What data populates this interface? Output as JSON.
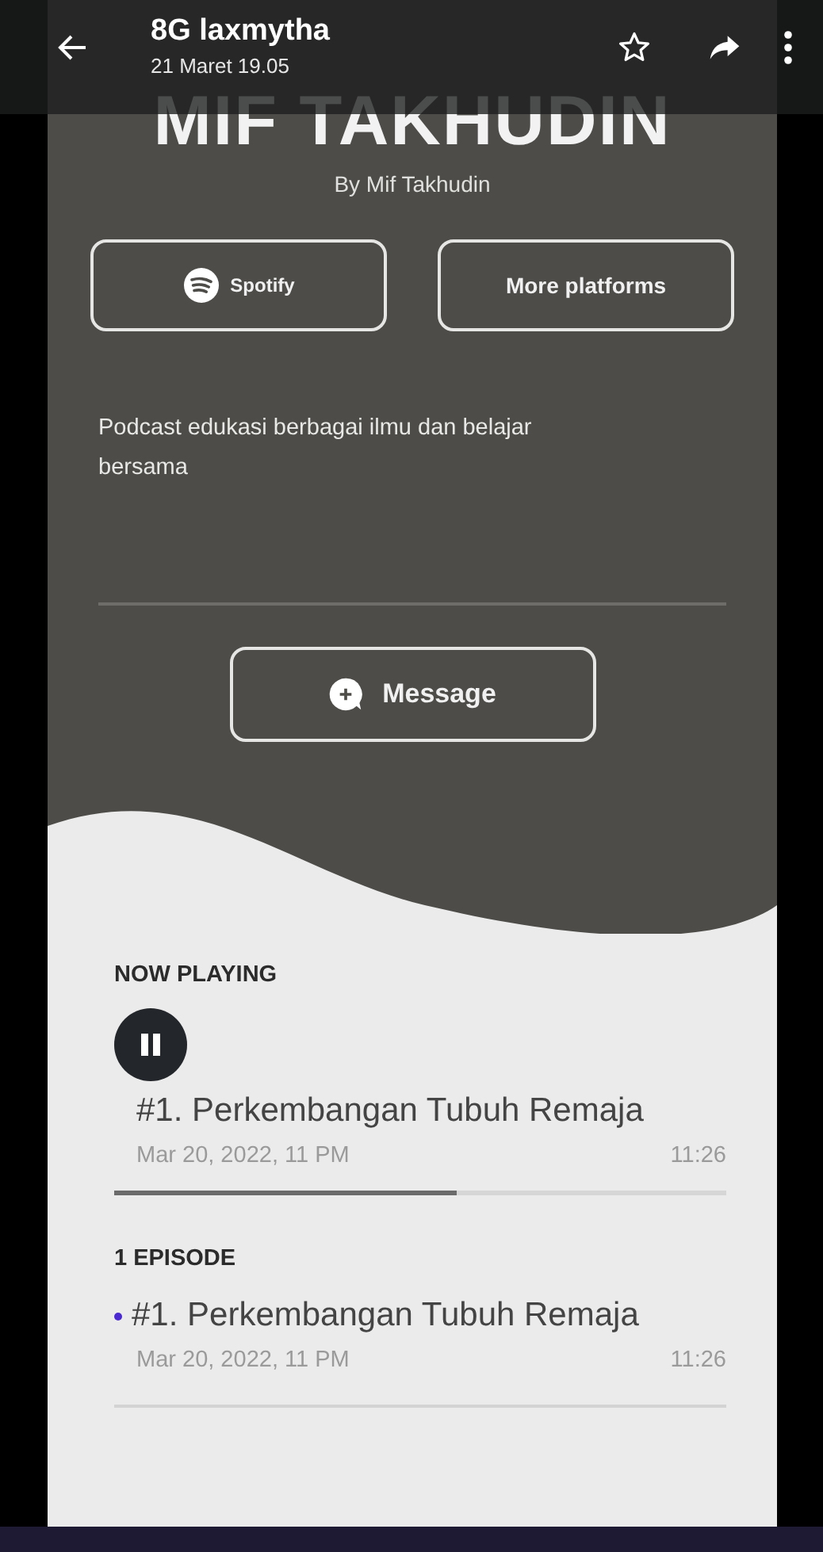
{
  "top_bar": {
    "title": "8G laxmytha",
    "subtitle": "21 Maret 19.05"
  },
  "podcast": {
    "title": "MIF TAKHUDIN",
    "author": "By Mif Takhudin",
    "platform_buttons": [
      {
        "label": "Spotify",
        "kind": "spotify"
      },
      {
        "label": "More platforms",
        "kind": "plain"
      }
    ],
    "description": "Podcast edukasi berbagai ilmu dan belajar bersama",
    "message_button": "Message"
  },
  "now_playing": {
    "heading": "NOW PLAYING",
    "playing": true,
    "title": "#1. Perkembangan Tubuh Remaja",
    "date": "Mar 20, 2022, 11 PM",
    "duration": "11:26",
    "level": 0.56
  },
  "episodes": {
    "heading": "1 EPISODE",
    "items": [
      {
        "title": "#1. Perkembangan Tubuh Remaja",
        "date": "Mar 20, 2022, 11 PM",
        "duration": "11:26",
        "unplayed": true
      }
    ]
  }
}
